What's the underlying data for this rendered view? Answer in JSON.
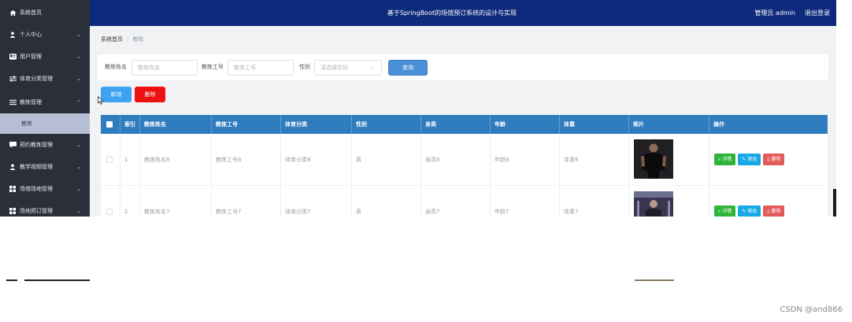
{
  "app": {
    "title": "基于SpringBoot的场馆预订系统的设计与实现",
    "admin_label": "管理员 admin",
    "logout": "退出登录"
  },
  "sidebar": {
    "items": [
      {
        "label": "系统首页",
        "icon": "home-icon",
        "has_arrow": false
      },
      {
        "label": "个人中心",
        "icon": "user-icon",
        "has_arrow": true
      },
      {
        "label": "用户管理",
        "icon": "id-card-icon",
        "has_arrow": true
      },
      {
        "label": "体育分类管理",
        "icon": "sliders-icon",
        "has_arrow": true
      },
      {
        "label": "教练管理",
        "icon": "list-icon",
        "has_arrow": true,
        "expanded": true
      },
      {
        "label": "预约教练管理",
        "icon": "message-icon",
        "has_arrow": true
      },
      {
        "label": "教学视频管理",
        "icon": "user-icon",
        "has_arrow": true
      },
      {
        "label": "场馆场地管理",
        "icon": "grid-icon",
        "has_arrow": true
      },
      {
        "label": "场地预订管理",
        "icon": "grid-icon",
        "has_arrow": true
      }
    ],
    "submenu": {
      "label": "教练"
    }
  },
  "breadcrumb": {
    "home": "系统首页",
    "current": "教练"
  },
  "search": {
    "name_label": "教练姓名",
    "name_placeholder": "教练姓名",
    "id_label": "教练工号",
    "id_placeholder": "教练工号",
    "gender_label": "性别",
    "gender_placeholder": "请选择性别",
    "button": "查询"
  },
  "actions": {
    "add": "新增",
    "delete": "删除"
  },
  "table": {
    "headers": [
      "索引",
      "教练姓名",
      "教练工号",
      "体育分类",
      "性别",
      "身高",
      "年龄",
      "体重",
      "照片",
      "操作"
    ],
    "rows": [
      {
        "index": "1",
        "name": "教练姓名8",
        "id": "教练工号8",
        "category": "体育分类8",
        "gender": "男",
        "height": "身高8",
        "age": "年龄8",
        "weight": "体重8"
      },
      {
        "index": "2",
        "name": "教练姓名7",
        "id": "教练工号7",
        "category": "体育分类7",
        "gender": "男",
        "height": "身高7",
        "age": "年龄7",
        "weight": "体重7"
      }
    ],
    "ops": {
      "detail": "详情",
      "edit": "修改",
      "delete": "删除"
    }
  },
  "colors": {
    "sidebar_bg": "#2b2f3a",
    "header_bg": "#0e2a7c",
    "table_header_bg": "#2f7cbf",
    "submenu_bg": "#b6bfd6",
    "add_button": "#3ea2f0",
    "delete_button": "#ee1111"
  },
  "watermark": "CSDN @and866"
}
